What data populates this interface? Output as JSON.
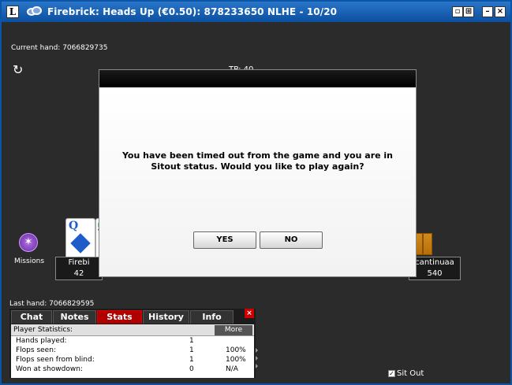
{
  "window": {
    "title": "Firebrick: Heads Up (€0.50): 878233650 NLHE - 10/20",
    "logo_letter": "L",
    "controls": {
      "restore": "▫",
      "grid": "⊞",
      "minimize": "–",
      "close": "×"
    }
  },
  "table": {
    "current_hand": "Current hand: 7066829735",
    "tp": "TP: 40",
    "missions_label": "Missions",
    "last_hand": "Last hand: 7066829595",
    "card_rank": "Q",
    "card2_rank": "5",
    "seat_left": {
      "name": "Firebi",
      "stack": "42"
    },
    "seat_right": {
      "name": "cantinuaa",
      "stack": "540"
    }
  },
  "dialog": {
    "message": "You have been timed out from the game and you are in Sitout status. Would you like to play again?",
    "yes_label": "YES",
    "no_label": "NO"
  },
  "panel": {
    "tabs": [
      "Chat",
      "Notes",
      "Stats",
      "History",
      "Info"
    ],
    "active_tab": "Stats",
    "header": "Player Statistics:",
    "more_label": "More",
    "close": "×",
    "rows": [
      {
        "label": "Hands played:",
        "v1": "1",
        "v2": ""
      },
      {
        "label": "Flops seen:",
        "v1": "1",
        "v2": "100%"
      },
      {
        "label": "Flops seen from blind:",
        "v1": "1",
        "v2": "100%"
      },
      {
        "label": "Won at showdown:",
        "v1": "0",
        "v2": "N/A"
      }
    ]
  },
  "sitout": {
    "label": "Sit Out",
    "checked": true
  }
}
